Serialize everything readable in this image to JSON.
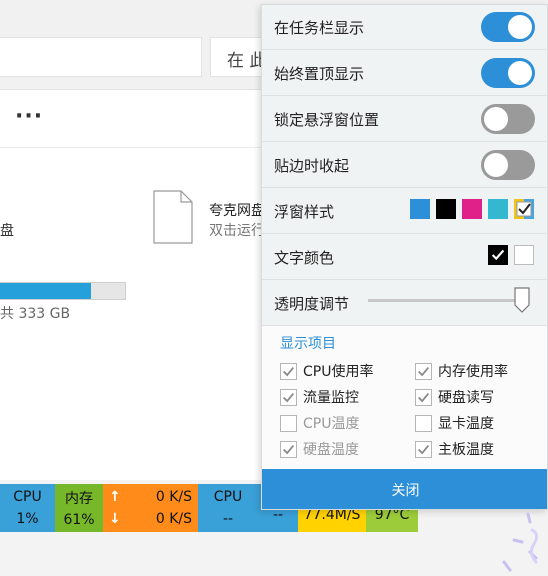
{
  "explorer": {
    "search_text": "在 此",
    "more": "···",
    "drive_label": "盘",
    "drive_used_fraction": 0.73,
    "drive_size": "共 333 GB",
    "app_name": "夸克网盘",
    "app_sub": "双击运行"
  },
  "monitor": {
    "cpu_label": "CPU",
    "cpu_value": "1%",
    "mem_label": "内存",
    "mem_value": "61%",
    "up_arrow": "↑",
    "up_value": "0 K/S",
    "down_arrow": "↓",
    "down_value": "0 K/S",
    "cpu_temp_label": "CPU",
    "cpu_temp_value": "--",
    "gpu_temp_value": "--",
    "disk_value": "77.4M/S",
    "board_temp_value": "97°C"
  },
  "panel": {
    "taskbar_label": "在任务栏显示",
    "taskbar_on": true,
    "ontop_label": "始终置顶显示",
    "ontop_on": true,
    "lock_label": "锁定悬浮窗位置",
    "lock_on": false,
    "snap_label": "贴边时收起",
    "snap_on": false,
    "style_label": "浮窗样式",
    "style_colors": [
      "#2d8fd8",
      "#000000",
      "#e0218a",
      "#34b8d0",
      "#f0c419"
    ],
    "text_color_label": "文字颜色",
    "opacity_label": "透明度调节",
    "opacity_value": 0.96,
    "items_title": "显示项目",
    "items": [
      {
        "label": "CPU使用率",
        "checked": true,
        "enabled": true
      },
      {
        "label": "内存使用率",
        "checked": true,
        "enabled": true
      },
      {
        "label": "流量监控",
        "checked": true,
        "enabled": true
      },
      {
        "label": "硬盘读写",
        "checked": true,
        "enabled": true
      },
      {
        "label": "CPU温度",
        "checked": false,
        "enabled": false
      },
      {
        "label": "显卡温度",
        "checked": false,
        "enabled": true
      },
      {
        "label": "硬盘温度",
        "checked": true,
        "enabled": false
      },
      {
        "label": "主板温度",
        "checked": true,
        "enabled": true
      }
    ],
    "close_label": "关闭"
  }
}
